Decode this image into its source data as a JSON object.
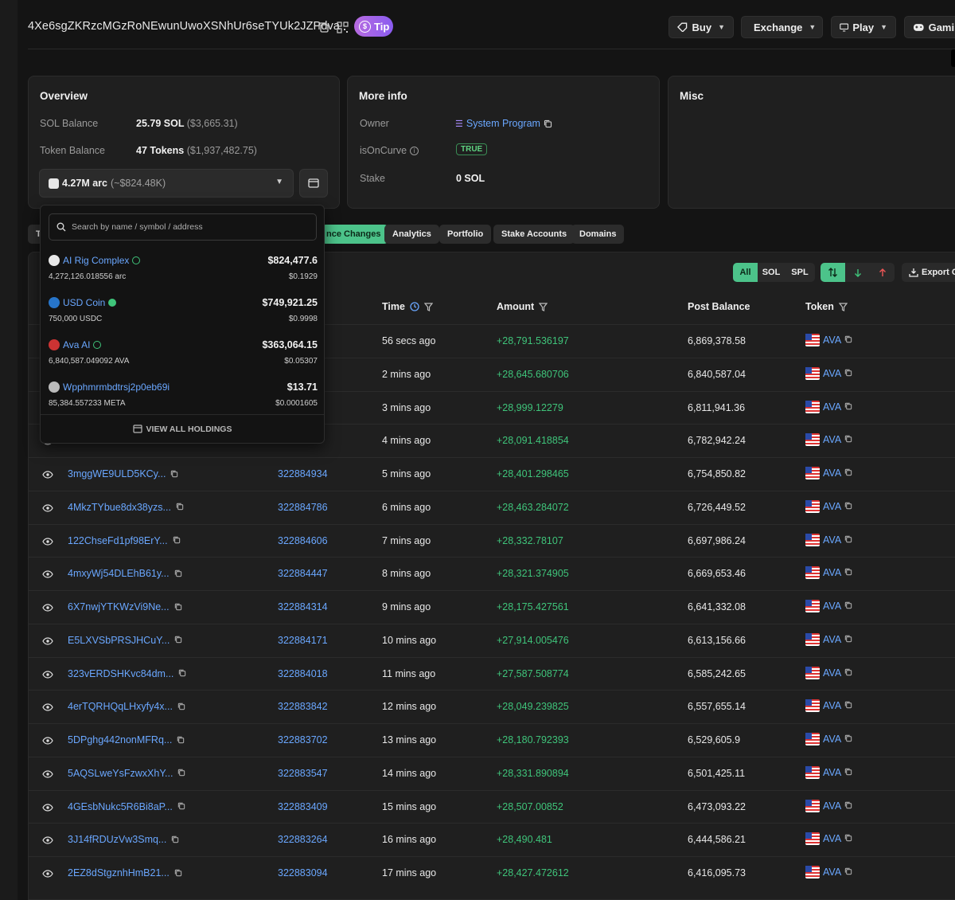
{
  "header": {
    "address": "4Xe6sgZKRzcMGzRoNEwunUwoXSNhUr6seTYUk2JZPdva",
    "tip_label": "Tip",
    "buttons": [
      {
        "label": "Buy"
      },
      {
        "label": "Exchange"
      },
      {
        "label": "Play"
      },
      {
        "label": "Gaming"
      }
    ]
  },
  "overview": {
    "title": "Overview",
    "sol_balance_label": "SOL Balance",
    "sol_balance_value": "25.79 SOL",
    "sol_balance_usd": "($3,665.31)",
    "token_balance_label": "Token Balance",
    "token_balance_value": "47 Tokens",
    "token_balance_usd": "($1,937,482.75)",
    "selected_token_amount": "4.27M arc",
    "selected_token_usd": "(~$824.48K)"
  },
  "more_info": {
    "title": "More info",
    "owner_label": "Owner",
    "owner_value": "System Program",
    "is_on_curve_label": "isOnCurve",
    "is_on_curve_value": "TRUE",
    "stake_label": "Stake",
    "stake_value": "0 SOL"
  },
  "misc": {
    "title": "Misc"
  },
  "tabs": [
    {
      "label": "T"
    },
    {
      "label": "nce Changes",
      "active": true
    },
    {
      "label": "Analytics"
    },
    {
      "label": "Portfolio"
    },
    {
      "label": "Stake Accounts"
    },
    {
      "label": "Domains"
    }
  ],
  "filters": {
    "type_options": [
      "All",
      "SOL",
      "SPL"
    ],
    "export_label": "Export CS"
  },
  "table": {
    "headers": {
      "time": "Time",
      "amount": "Amount",
      "post_balance": "Post Balance",
      "token": "Token"
    },
    "rows": [
      {
        "sig": "",
        "slot": "",
        "time": "56 secs ago",
        "amount": "+28,791.536197",
        "post": "6,869,378.58",
        "token": "AVA"
      },
      {
        "sig": "",
        "slot": "",
        "time": "2 mins ago",
        "amount": "+28,645.680706",
        "post": "6,840,587.04",
        "token": "AVA"
      },
      {
        "sig": "",
        "slot": "",
        "time": "3 mins ago",
        "amount": "+28,999.12279",
        "post": "6,811,941.36",
        "token": "AVA"
      },
      {
        "sig": "",
        "slot": "",
        "time": "4 mins ago",
        "amount": "+28,091.418854",
        "post": "6,782,942.24",
        "token": "AVA"
      },
      {
        "sig": "3mggWE9ULD5KCy...",
        "slot": "322884934",
        "time": "5 mins ago",
        "amount": "+28,401.298465",
        "post": "6,754,850.82",
        "token": "AVA"
      },
      {
        "sig": "4MkzTYbue8dx38yzs...",
        "slot": "322884786",
        "time": "6 mins ago",
        "amount": "+28,463.284072",
        "post": "6,726,449.52",
        "token": "AVA"
      },
      {
        "sig": "122ChseFd1pf98ErY...",
        "slot": "322884606",
        "time": "7 mins ago",
        "amount": "+28,332.78107",
        "post": "6,697,986.24",
        "token": "AVA"
      },
      {
        "sig": "4mxyWj54DLEhB61y...",
        "slot": "322884447",
        "time": "8 mins ago",
        "amount": "+28,321.374905",
        "post": "6,669,653.46",
        "token": "AVA"
      },
      {
        "sig": "6X7nwjYTKWzVi9Ne...",
        "slot": "322884314",
        "time": "9 mins ago",
        "amount": "+28,175.427561",
        "post": "6,641,332.08",
        "token": "AVA"
      },
      {
        "sig": "E5LXVSbPRSJHCuY...",
        "slot": "322884171",
        "time": "10 mins ago",
        "amount": "+27,914.005476",
        "post": "6,613,156.66",
        "token": "AVA"
      },
      {
        "sig": "323vERDSHKvc84dm...",
        "slot": "322884018",
        "time": "11 mins ago",
        "amount": "+27,587.508774",
        "post": "6,585,242.65",
        "token": "AVA"
      },
      {
        "sig": "4erTQRHQqLHxyfy4x...",
        "slot": "322883842",
        "time": "12 mins ago",
        "amount": "+28,049.239825",
        "post": "6,557,655.14",
        "token": "AVA"
      },
      {
        "sig": "5DPghg442nonMFRq...",
        "slot": "322883702",
        "time": "13 mins ago",
        "amount": "+28,180.792393",
        "post": "6,529,605.9",
        "token": "AVA"
      },
      {
        "sig": "5AQSLweYsFzwxXhY...",
        "slot": "322883547",
        "time": "14 mins ago",
        "amount": "+28,331.890894",
        "post": "6,501,425.11",
        "token": "AVA"
      },
      {
        "sig": "4GEsbNukc5R6Bi8aP...",
        "slot": "322883409",
        "time": "15 mins ago",
        "amount": "+28,507.00852",
        "post": "6,473,093.22",
        "token": "AVA"
      },
      {
        "sig": "3J14fRDUzVw3Smq...",
        "slot": "322883264",
        "time": "16 mins ago",
        "amount": "+28,490.481",
        "post": "6,444,586.21",
        "token": "AVA"
      },
      {
        "sig": "2EZ8dStgznhHmB21...",
        "slot": "322883094",
        "time": "17 mins ago",
        "amount": "+28,427.472612",
        "post": "6,416,095.73",
        "token": "AVA"
      }
    ]
  },
  "dropdown": {
    "search_placeholder": "Search by name / symbol / address",
    "items": [
      {
        "name": "AI Rig Complex",
        "amount": "4,272,126.018556 arc",
        "usd": "$824,477.6",
        "price": "$0.1929",
        "icon_color": "#e8e8e8",
        "verified": true
      },
      {
        "name": "USD Coin",
        "amount": "750,000 USDC",
        "usd": "$749,921.25",
        "price": "$0.9998",
        "icon_color": "#2775ca",
        "verified": true
      },
      {
        "name": "Ava AI",
        "amount": "6,840,587.049092 AVA",
        "usd": "$363,064.15",
        "price": "$0.05307",
        "icon_color": "#c33",
        "verified": true
      },
      {
        "name": "Wpphmrmbdtrsj2p0eb69i",
        "amount": "85,384.557233 META",
        "usd": "$13.71",
        "price": "$0.0001605",
        "icon_color": "#bbb",
        "verified": false
      }
    ],
    "footer_label": "VIEW ALL HOLDINGS"
  },
  "colors": {
    "accent_green": "#4cc38a",
    "link_blue": "#6aa7ff",
    "amount_green": "#3fc47a",
    "background": "#141414",
    "card": "#1f1f1f"
  }
}
